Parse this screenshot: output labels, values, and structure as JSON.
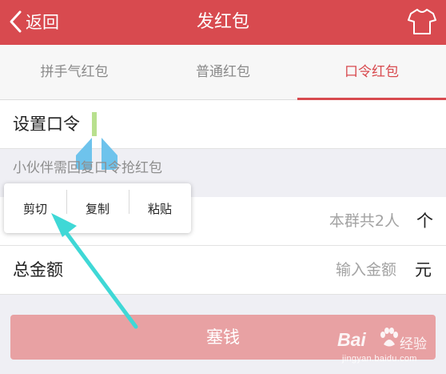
{
  "header": {
    "back_label": "返回",
    "title": "发红包",
    "icons": {
      "back": "chevron-left-icon",
      "theme": "tshirt-icon"
    }
  },
  "tabs": [
    {
      "label": "拼手气红包",
      "active": false
    },
    {
      "label": "普通红包",
      "active": false
    },
    {
      "label": "口令红包",
      "active": true
    }
  ],
  "form": {
    "code_label": "设置口令",
    "code_value": "",
    "code_hint": "小伙伴需回复口令抢红包",
    "count_placeholder": "本群共2人",
    "count_unit": "个",
    "amount_label": "总金额",
    "amount_placeholder": "输入金额",
    "amount_unit": "元"
  },
  "context_menu": {
    "items": [
      "剪切",
      "复制",
      "粘贴"
    ]
  },
  "submit_label": "塞钱",
  "watermark": {
    "logo": "Bai",
    "text": "经验",
    "url": "jingyan.baidu.com"
  },
  "colors": {
    "header_bg": "#d84a4f",
    "accent": "#d84a4f",
    "submit_disabled": "#e8a1a3",
    "arrow": "#3fd8d6",
    "cursor_handle": "#6ec3ec",
    "text_cursor": "#b8e08e"
  }
}
